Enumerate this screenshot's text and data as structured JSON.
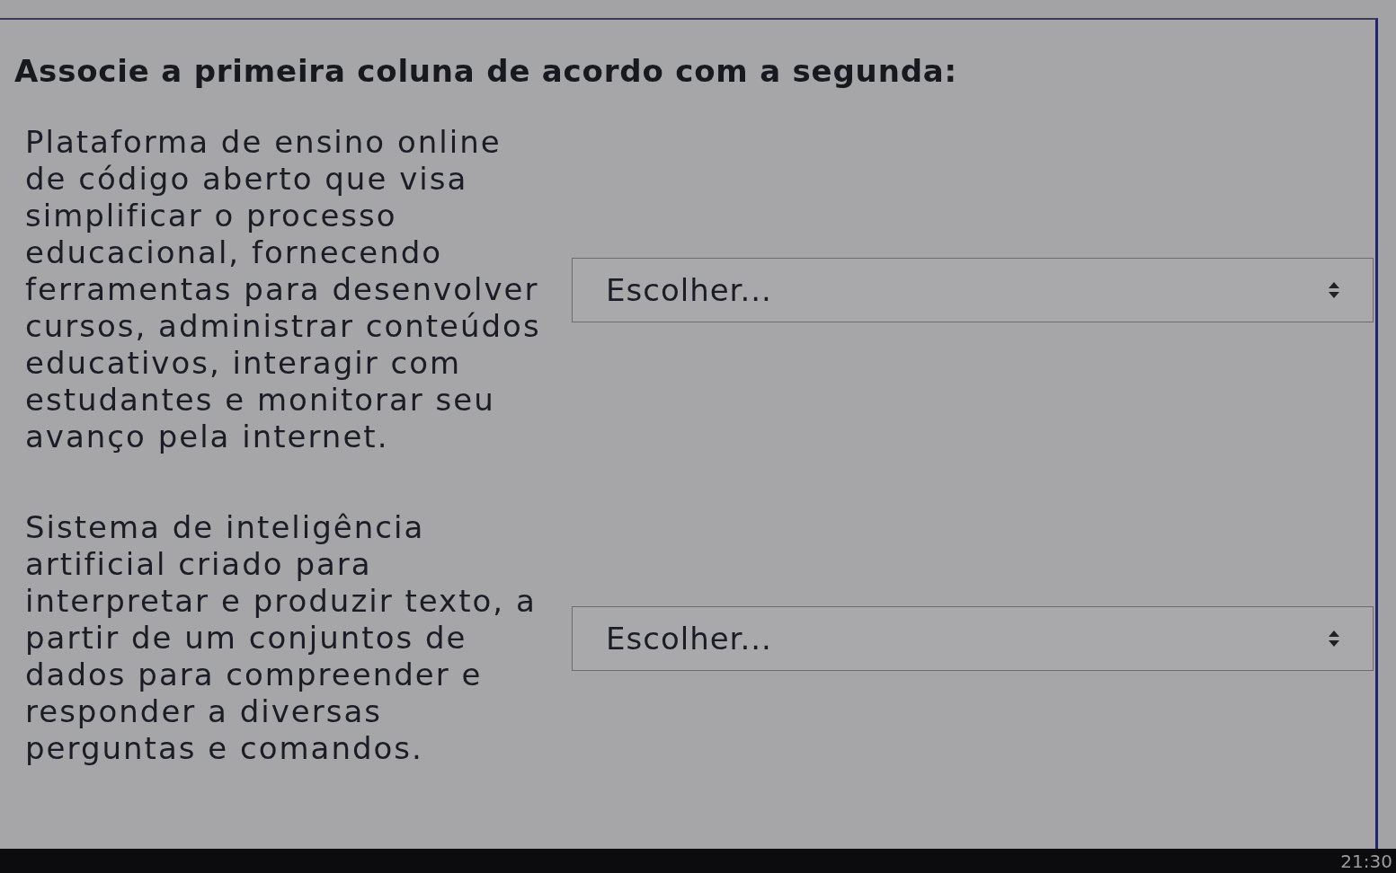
{
  "question": {
    "text": "Associe a primeira coluna de acordo com a segunda:"
  },
  "pairs": [
    {
      "prompt": "Plataforma de ensino online de código aberto que visa simplificar o processo educacional, fornecendo ferramentas para desenvolver cursos, administrar conteúdos educativos, interagir com estudantes e monitorar seu avanço pela internet.",
      "select": {
        "selected_option": "Escolher..."
      }
    },
    {
      "prompt": "Sistema de inteligência artificial criado para interpretar e produzir texto, a partir de um conjuntos de dados para compreender e responder a diversas perguntas e comandos.",
      "select": {
        "selected_option": "Escolher..."
      }
    }
  ],
  "taskbar": {
    "clock": "21:30"
  }
}
